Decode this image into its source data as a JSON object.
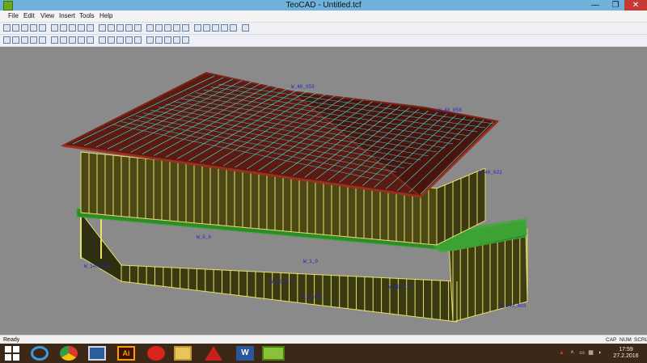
{
  "window": {
    "title": "TeoCAD - Untitled.tcf",
    "minimize_glyph": "—",
    "maximize_glyph": "❐",
    "close_glyph": "✕"
  },
  "menu": [
    "File",
    "Edit",
    "View",
    "Insert",
    "Tools",
    "Help"
  ],
  "toolbar_primary_icons": [
    "new-file-icon",
    "open-folder-icon",
    "save-icon",
    "print-icon",
    "undo-icon",
    "point-icon",
    "line-icon",
    "clear-icon",
    "grid-icon",
    "copy-icon",
    "box-icon",
    "box-icon",
    "box-icon",
    "box-icon",
    "box-icon",
    "box-icon",
    "box-icon",
    "box-icon",
    "image-icon",
    "select-icon",
    "move-icon",
    "rotate-icon",
    "truss-icon",
    "ruler-icon",
    "macro-icon",
    "help-icon"
  ],
  "toolbar_secondary_icons": [
    "view-iso-icon",
    "view-top-icon",
    "render-icon",
    "wireframe-icon",
    "zoom-in-icon",
    "zoom-out-icon",
    "zoom-fit-icon",
    "cube-front-icon",
    "cube-back-icon",
    "cube-left-icon",
    "cube-right-icon",
    "cube-top-icon",
    "cube-bottom-icon",
    "cube-iso-icon",
    "layer-icon",
    "layer-icon",
    "layer-icon",
    "layer-icon",
    "layer-icon",
    "layer-icon"
  ],
  "viewport": {
    "colors": {
      "background": "#8a8a8a",
      "roof": "#7b2418",
      "studs": "#e8e06a",
      "trusses": "#3fd2d2",
      "floor_joists": "#3fa836",
      "labels": "#2323c8"
    },
    "wall_labels": [
      "W_40_059",
      "W_40_058",
      "W_40_022",
      "W_140_002",
      "W_140_003",
      "W_90_0_6",
      "W_90_0_2",
      "W_1_001",
      "W_1_0",
      "W_0_0"
    ]
  },
  "status": {
    "text": "Ready",
    "caps": "CAP",
    "num": "NUM",
    "scroll": "SCRL"
  },
  "taskbar": {
    "pinned": [
      "windows-start-icon",
      "internet-explorer-icon",
      "chrome-icon",
      "remote-desktop-icon",
      "illustrator-icon",
      "power-icon",
      "file-explorer-icon",
      "autocad-icon",
      "word-icon",
      "teocad-icon"
    ],
    "time": "17:59",
    "date": "27.2.2016"
  }
}
